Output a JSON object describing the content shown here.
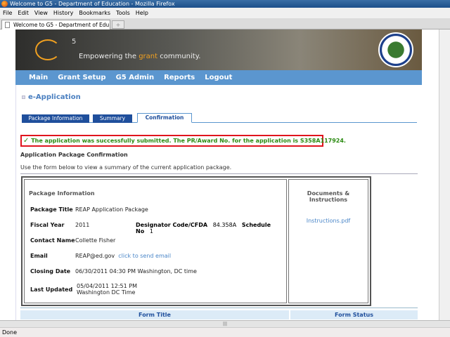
{
  "window": {
    "title": "Welcome to G5 - Department of Education - Mozilla Firefox"
  },
  "menu": [
    "File",
    "Edit",
    "View",
    "History",
    "Bookmarks",
    "Tools",
    "Help"
  ],
  "tab": {
    "title": "Welcome to G5 - Department of Edu...",
    "new_tab": "+"
  },
  "banner": {
    "logo": "G5",
    "logo_sup": "5",
    "tagline_pre": "Empowering the ",
    "tagline_grant": "grant",
    "tagline_post": " community."
  },
  "nav": [
    "Main",
    "Grant Setup",
    "G5 Admin",
    "Reports",
    "Logout"
  ],
  "page": {
    "title": "e-Application",
    "tabs": [
      "Package Information",
      "Summary",
      "Confirmation"
    ],
    "active_tab": "Confirmation",
    "success": "The application was successfully submitted. The PR/Award No. for the application is S358A117924.",
    "subtitle": "Application Package Confirmation",
    "instructions": "Use the form below to view a summary of the current application package.",
    "package": {
      "heading": "Package Information",
      "title_label": "Package Title",
      "title": "REAP Application Package",
      "fy_label": "Fiscal Year",
      "fy": "2011",
      "cfda_label": "Designator Code/CFDA",
      "cfda": "84.358A",
      "sched_label": "Schedule No",
      "sched": "1",
      "contact_label": "Contact Name",
      "contact": "Collette Fisher",
      "email_label": "Email",
      "email": "REAP@ed.gov",
      "email_link": "click to send email",
      "closing_label": "Closing Date",
      "closing": "06/30/2011 04:30 PM Washington, DC time",
      "updated_label": "Last Updated",
      "updated_1": "05/04/2011 12:51 PM",
      "updated_2": "Washington DC Time"
    },
    "docs": {
      "heading": "Documents & Instructions",
      "link": "Instructions.pdf"
    },
    "forms_table": {
      "headers": [
        "Form Title",
        "Form Status"
      ]
    }
  },
  "status": "Done",
  "colors": {
    "nav": "#5b96cf",
    "tab": "#1f4f9c",
    "success": "#2a8a10",
    "highlight": "#e0141e"
  }
}
